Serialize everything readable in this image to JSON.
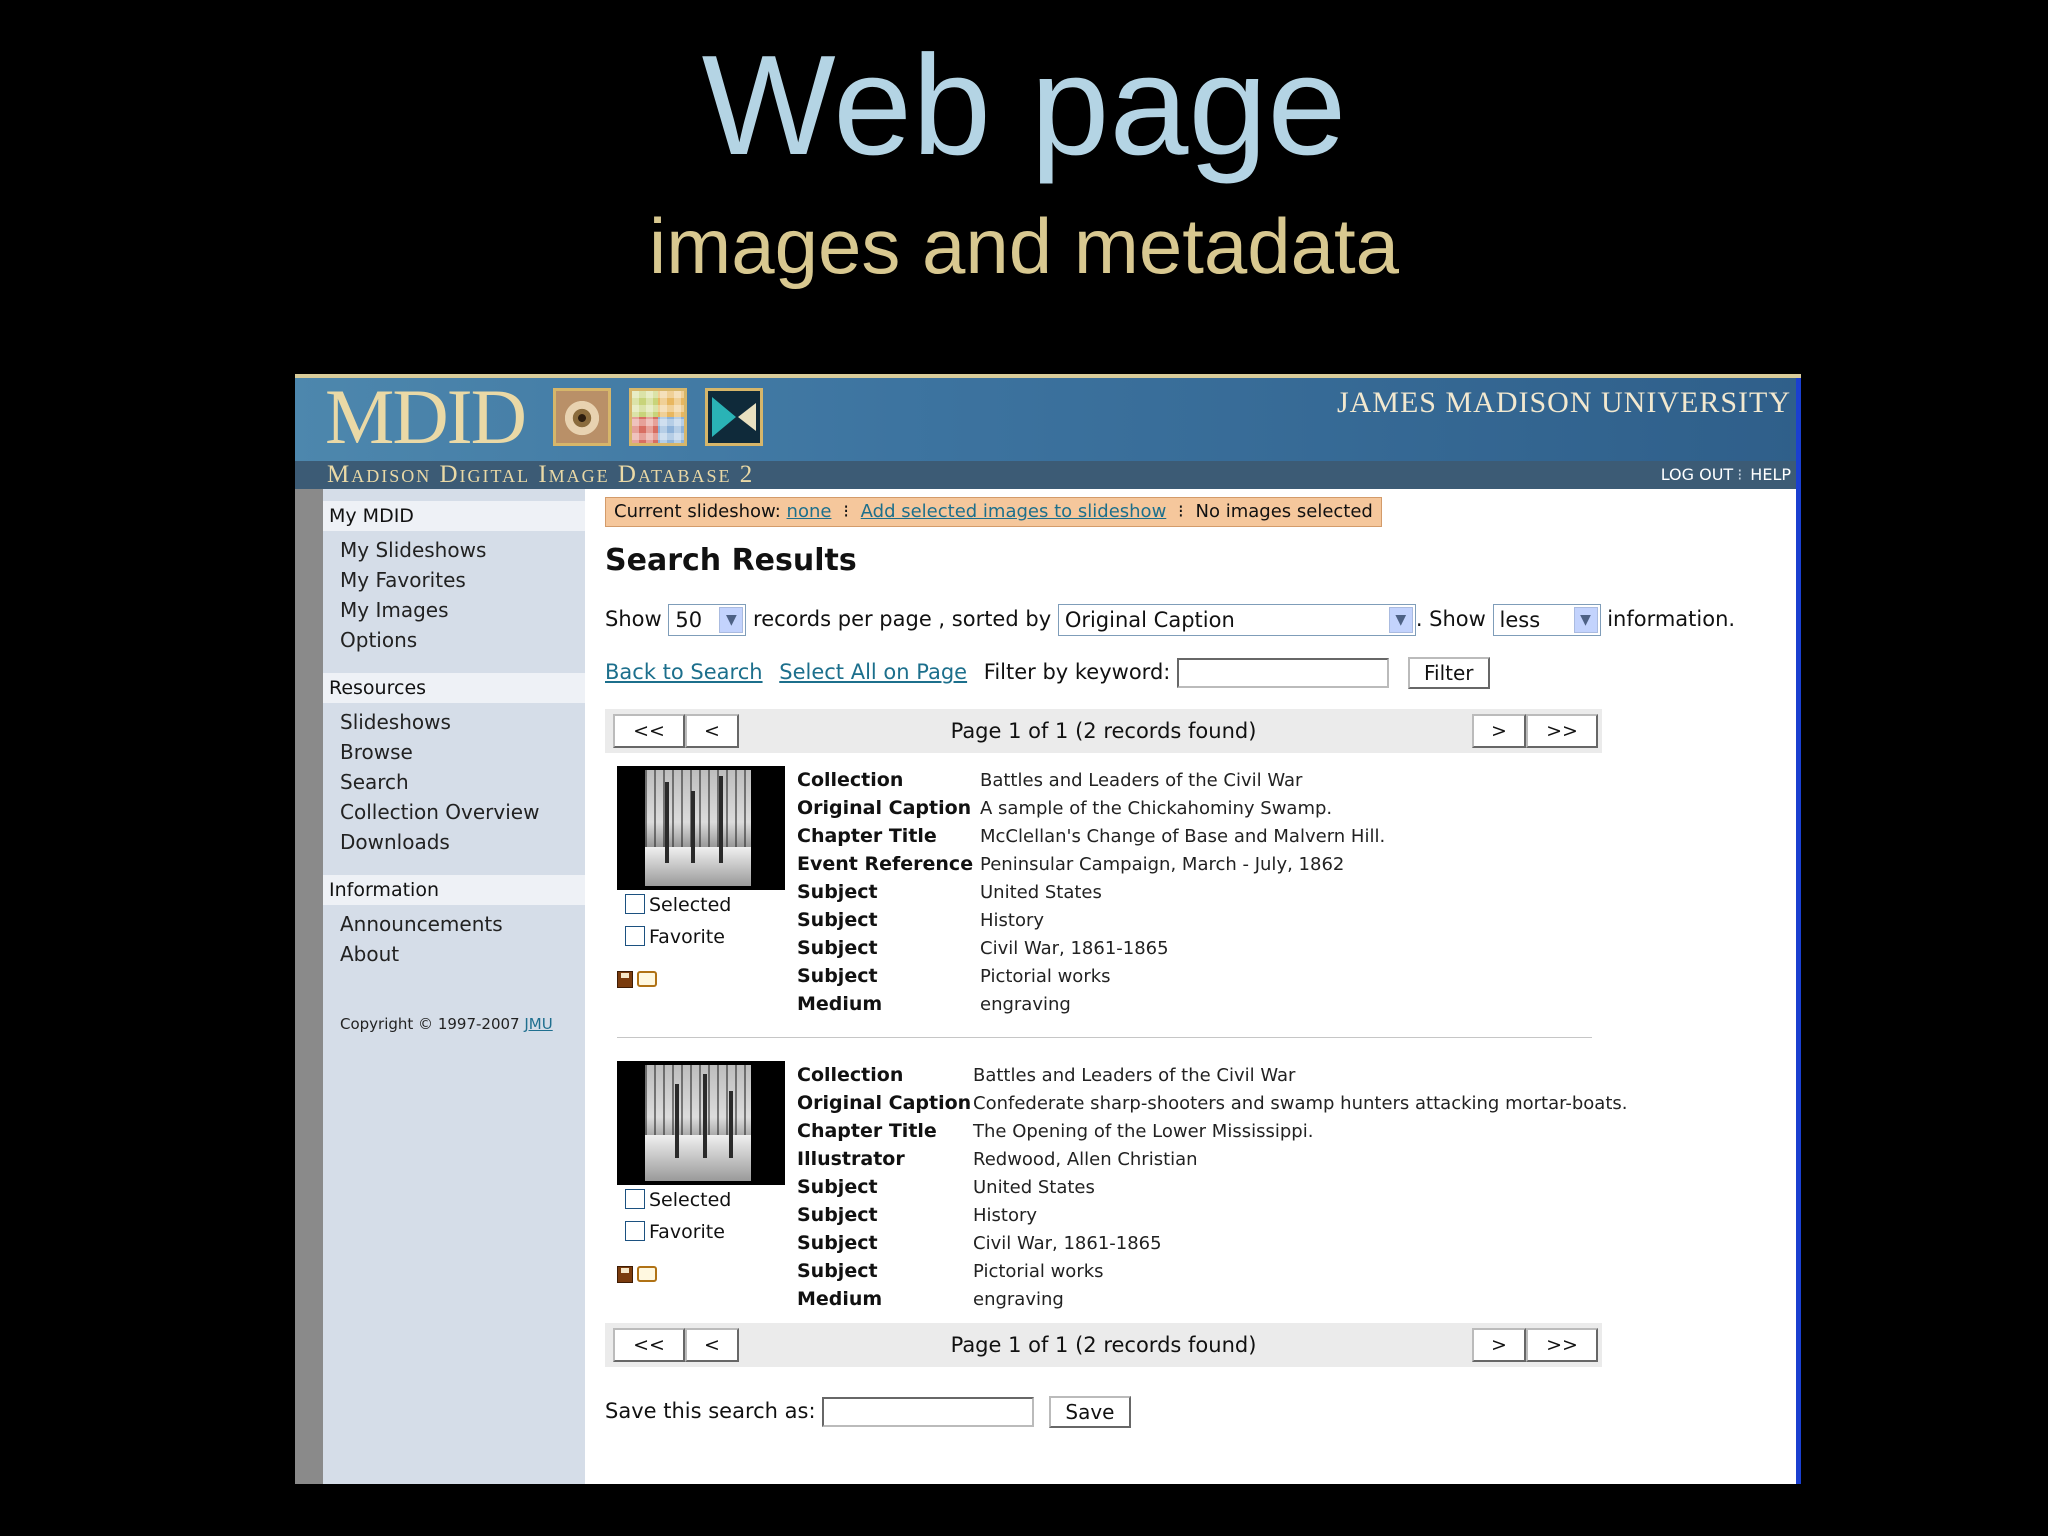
{
  "slide": {
    "title": "Web page",
    "subtitle": "images and metadata"
  },
  "header": {
    "logo": "MDID",
    "university": "JAMES MADISON UNIVERSITY",
    "db_name": "Madison Digital Image Database 2",
    "logout": "LOG OUT",
    "help": "HELP",
    "colors": {
      "banner": "#3d74a0",
      "subbar": "#3c5b75",
      "logo_text": "#ead9a6"
    }
  },
  "sidebar": {
    "sections": [
      {
        "title": "My MDID",
        "items": [
          "My Slideshows",
          "My Favorites",
          "My Images",
          "Options"
        ]
      },
      {
        "title": "Resources",
        "items": [
          "Slideshows",
          "Browse",
          "Search",
          "Collection Overview",
          "Downloads"
        ]
      },
      {
        "title": "Information",
        "items": [
          "Announcements",
          "About"
        ]
      }
    ],
    "copyright_text": "Copyright © 1997-2007",
    "copyright_link": "JMU"
  },
  "slideshow_bar": {
    "label": "Current slideshow:",
    "current": "none",
    "add_link": "Add selected images to slideshow",
    "status": "No images selected"
  },
  "results": {
    "title": "Search Results",
    "show_label": "Show",
    "per_page_value": "50",
    "per_page_suffix": "records per page , sorted by",
    "sort_value": "Original Caption",
    "show_label_2": ". Show",
    "info_value": "less",
    "info_suffix": "information.",
    "back_link": "Back to Search",
    "select_all_link": "Select All on Page",
    "filter_label": "Filter by keyword:",
    "filter_placeholder": "",
    "filter_button": "Filter"
  },
  "pager": {
    "first": "<<",
    "prev": "<",
    "next": ">",
    "last": ">>",
    "text": "Page 1 of 1 (2 records found)"
  },
  "records": [
    {
      "selected_label": "Selected",
      "favorite_label": "Favorite",
      "icons": [
        "save-disk-icon",
        "comment-icon"
      ],
      "fields": [
        {
          "key": "Collection",
          "value": "Battles and Leaders of the Civil War"
        },
        {
          "key": "Original Caption",
          "value": "A sample of the Chickahominy Swamp."
        },
        {
          "key": "Chapter Title",
          "value": "McClellan's Change of Base and Malvern Hill."
        },
        {
          "key": "Event Reference",
          "value": "Peninsular Campaign, March - July, 1862"
        },
        {
          "key": "Subject",
          "value": "United States"
        },
        {
          "key": "Subject",
          "value": "History"
        },
        {
          "key": "Subject",
          "value": "Civil War, 1861-1865"
        },
        {
          "key": "Subject",
          "value": "Pictorial works"
        },
        {
          "key": "Medium",
          "value": "engraving"
        }
      ]
    },
    {
      "selected_label": "Selected",
      "favorite_label": "Favorite",
      "icons": [
        "save-disk-icon",
        "comment-icon"
      ],
      "fields": [
        {
          "key": "Collection",
          "value": "Battles and Leaders of the Civil War"
        },
        {
          "key": "Original Caption",
          "value": "Confederate sharp-shooters and swamp hunters attacking mortar-boats."
        },
        {
          "key": "Chapter Title",
          "value": "The Opening of the Lower Mississippi."
        },
        {
          "key": "Illustrator",
          "value": "Redwood, Allen Christian"
        },
        {
          "key": "Subject",
          "value": "United States"
        },
        {
          "key": "Subject",
          "value": "History"
        },
        {
          "key": "Subject",
          "value": "Civil War, 1861-1865"
        },
        {
          "key": "Subject",
          "value": "Pictorial works"
        },
        {
          "key": "Medium",
          "value": "engraving"
        }
      ]
    }
  ],
  "save_search": {
    "label": "Save this search as:",
    "button": "Save"
  }
}
